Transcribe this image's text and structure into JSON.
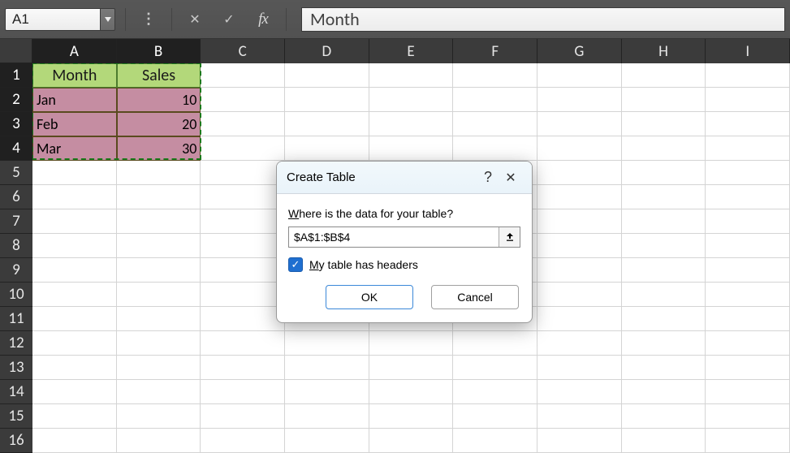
{
  "formula_bar": {
    "name_box": "A1",
    "cancel_icon": "✕",
    "confirm_icon": "✓",
    "fx_label": "fx",
    "value": "Month"
  },
  "columns": [
    "A",
    "B",
    "C",
    "D",
    "E",
    "F",
    "G",
    "H",
    "I"
  ],
  "rows": [
    "1",
    "2",
    "3",
    "4",
    "5",
    "6",
    "7",
    "8",
    "9",
    "10",
    "11",
    "12",
    "13",
    "14",
    "15",
    "16"
  ],
  "selected_cols": [
    "A",
    "B"
  ],
  "selected_rows": [
    "1",
    "2",
    "3",
    "4"
  ],
  "table_headers": {
    "A": "Month",
    "B": "Sales"
  },
  "table_rows": [
    {
      "A": "Jan",
      "B": "10"
    },
    {
      "A": "Feb",
      "B": "20"
    },
    {
      "A": "Mar",
      "B": "30"
    }
  ],
  "dialog": {
    "title": "Create Table",
    "help_glyph": "?",
    "close_glyph": "✕",
    "prompt_pre": "W",
    "prompt_post": "here is the data for your table?",
    "range_value": "$A$1:$B$4",
    "picker_glyph": "⬆",
    "chk_check": "✓",
    "chk_pre": "M",
    "chk_post": "y table has headers",
    "ok": "OK",
    "cancel": "Cancel"
  }
}
